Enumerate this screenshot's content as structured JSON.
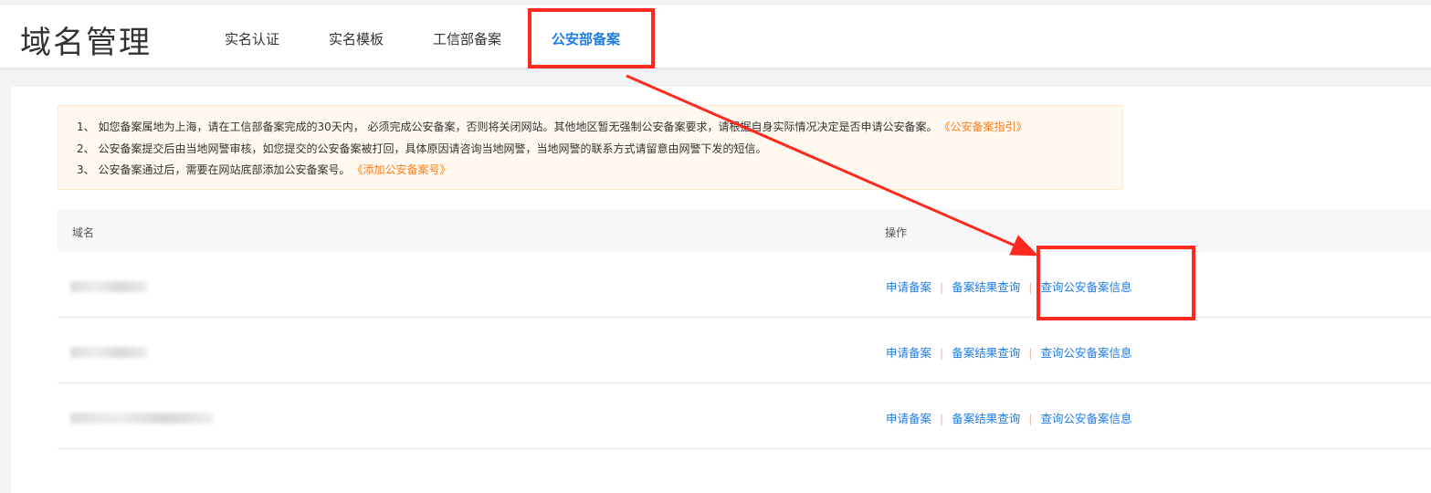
{
  "header": {
    "title": "域名管理",
    "tabs": [
      {
        "label": "实名认证"
      },
      {
        "label": "实名模板"
      },
      {
        "label": "工信部备案"
      },
      {
        "label": "公安部备案",
        "active": true
      }
    ]
  },
  "notice": {
    "lines": [
      {
        "text": "1、 如您备案属地为上海，请在工信部备案完成的30天内， 必须完成公安备案，否则将关闭网站。其他地区暂无强制公安备案要求，请根据自身实际情况决定是否申请公安备案。",
        "link": "《公安备案指引》"
      },
      {
        "text": "2、 公安备案提交后由当地网警审核，如您提交的公安备案被打回，具体原因请咨询当地网警，当地网警的联系方式请留意由网警下发的短信。"
      },
      {
        "text": "3、 公安备案通过后，需要在网站底部添加公安备案号。",
        "link": "《添加公安备案号》"
      }
    ]
  },
  "table": {
    "columns": [
      "域名",
      "操作"
    ],
    "actions": [
      "申请备案",
      "备案结果查询",
      "查询公安备案信息"
    ],
    "separator": "|"
  },
  "colors": {
    "accent": "#1e7ce8",
    "link_orange": "#ff7d1a",
    "annotation": "#ff2a1f"
  }
}
